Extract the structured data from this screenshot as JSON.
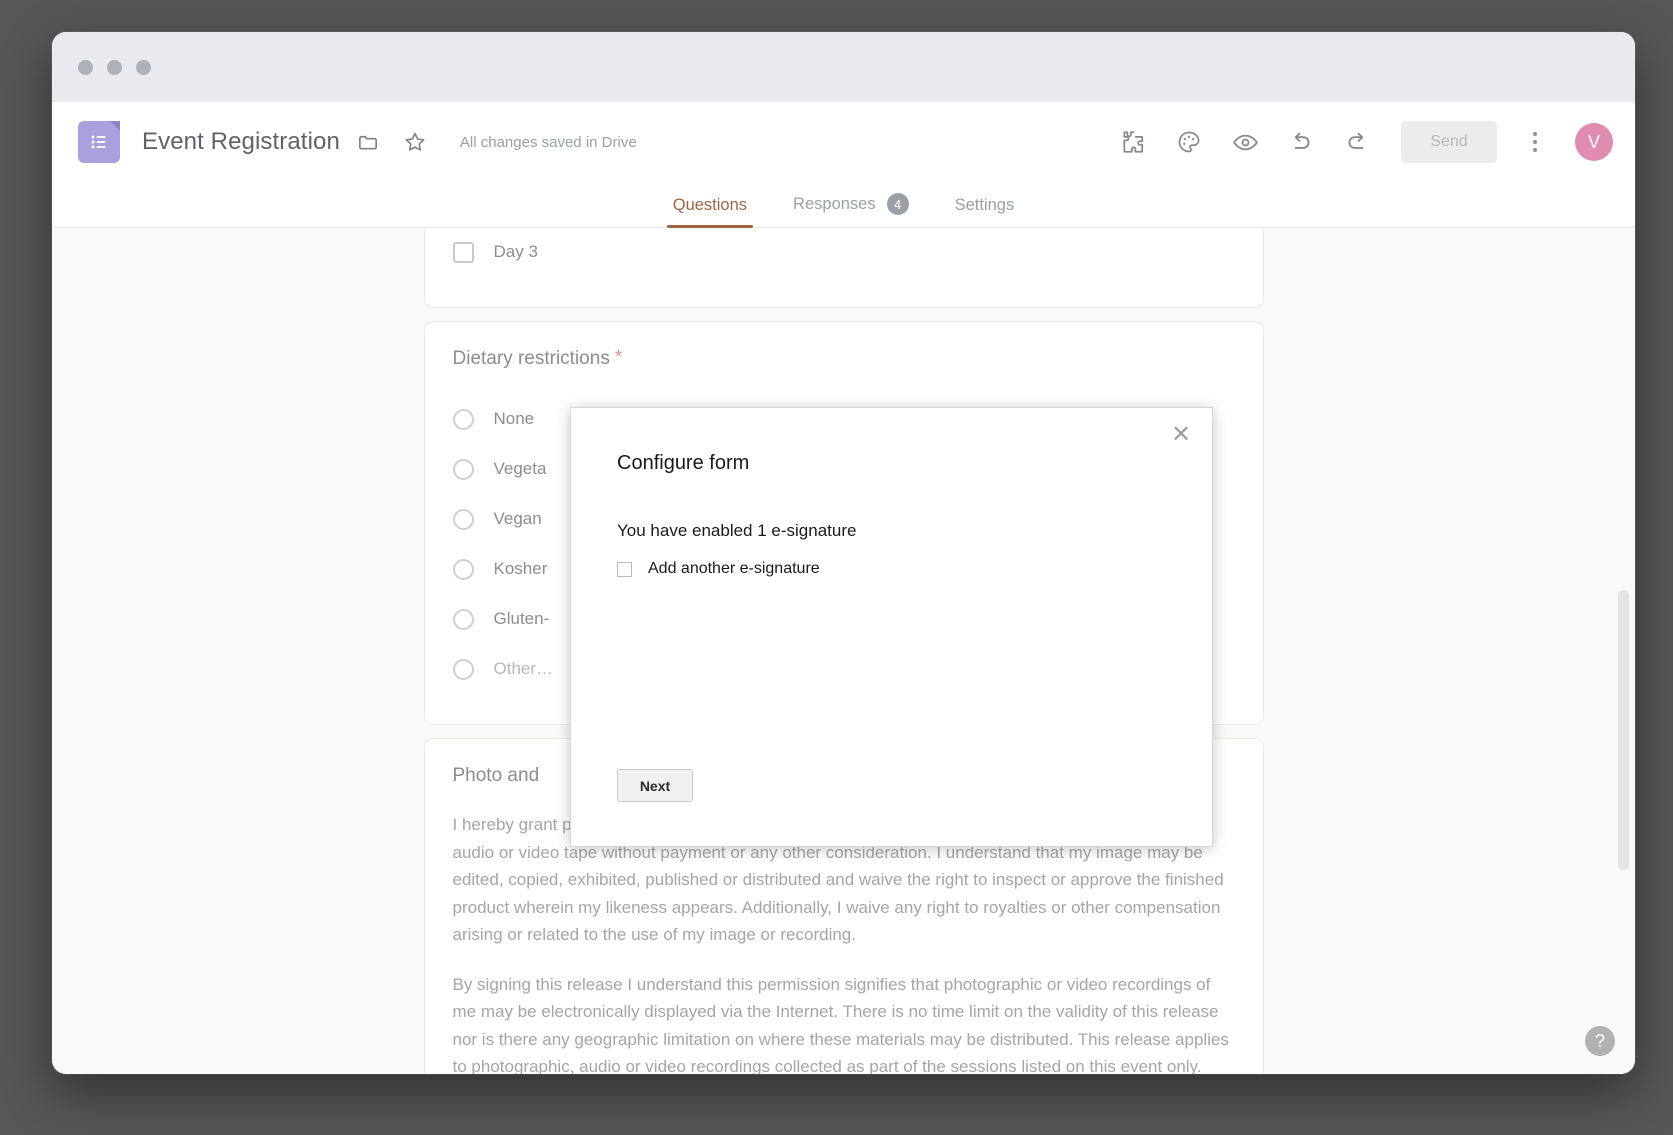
{
  "window": {
    "traffic_lights": [
      "close",
      "minimize",
      "maximize"
    ]
  },
  "header": {
    "app_icon": "google-forms-icon",
    "doc_title": "Event Registration",
    "folder_icon": "folder-icon",
    "star_icon": "star-icon",
    "save_status": "All changes saved in Drive",
    "tools": [
      {
        "name": "addons-icon",
        "glyph": "puzzle"
      },
      {
        "name": "theme-icon",
        "glyph": "palette"
      },
      {
        "name": "preview-icon",
        "glyph": "eye"
      },
      {
        "name": "undo-icon",
        "glyph": "undo"
      },
      {
        "name": "redo-icon",
        "glyph": "redo"
      }
    ],
    "send_label": "Send",
    "more_icon": "kebab-menu-icon",
    "avatar_initial": "V",
    "avatar_color": "#e08bb0"
  },
  "tabs": [
    {
      "label": "Questions",
      "active": true,
      "badge": ""
    },
    {
      "label": "Responses",
      "active": false,
      "badge": "4"
    },
    {
      "label": "Settings",
      "active": false,
      "badge": ""
    }
  ],
  "form": {
    "attendance_card": {
      "visible_option": {
        "label": "Day 3",
        "type": "checkbox",
        "checked": false
      }
    },
    "dietary_card": {
      "title": "Dietary restrictions",
      "required_marker": "*",
      "options": [
        {
          "label": "None",
          "muted": false
        },
        {
          "label": "Vegeta",
          "muted": false
        },
        {
          "label": "Vegan",
          "muted": false
        },
        {
          "label": "Kosher",
          "muted": false
        },
        {
          "label": "Gluten-",
          "muted": false
        },
        {
          "label": "Other…",
          "muted": true
        }
      ]
    },
    "photo_card": {
      "title": "Photo and",
      "paragraphs": [
        "I hereby grant permission to the rights of my image, likeness and sound of my voice as recorded on audio or video tape without payment or any other consideration. I understand that my image may be edited, copied, exhibited, published or distributed and waive the right to inspect or approve the finished product wherein my likeness appears. Additionally, I waive any right to royalties or other compensation arising or related to the use of my image or recording.",
        "By signing this release I understand this permission signifies that photographic or video recordings of me may be electronically displayed via the Internet. There is no time limit on the validity of this release nor is there any geographic limitation on where these materials may be distributed. This release applies to photographic, audio or video recordings collected as part of the sessions listed on this event only."
      ]
    }
  },
  "dialog": {
    "title": "Configure form",
    "close_icon": "close-icon",
    "message": "You have enabled 1 e-signature",
    "checkbox_label": "Add another e-signature",
    "checkbox_checked": false,
    "next_label": "Next"
  },
  "help": {
    "label": "?"
  },
  "colors": {
    "accent": "#9c6644",
    "brand_purple": "#a9a0dd",
    "avatar_pink": "#e08bb0",
    "required_red": "#e8908f",
    "page_bg": "#faf9f7"
  }
}
